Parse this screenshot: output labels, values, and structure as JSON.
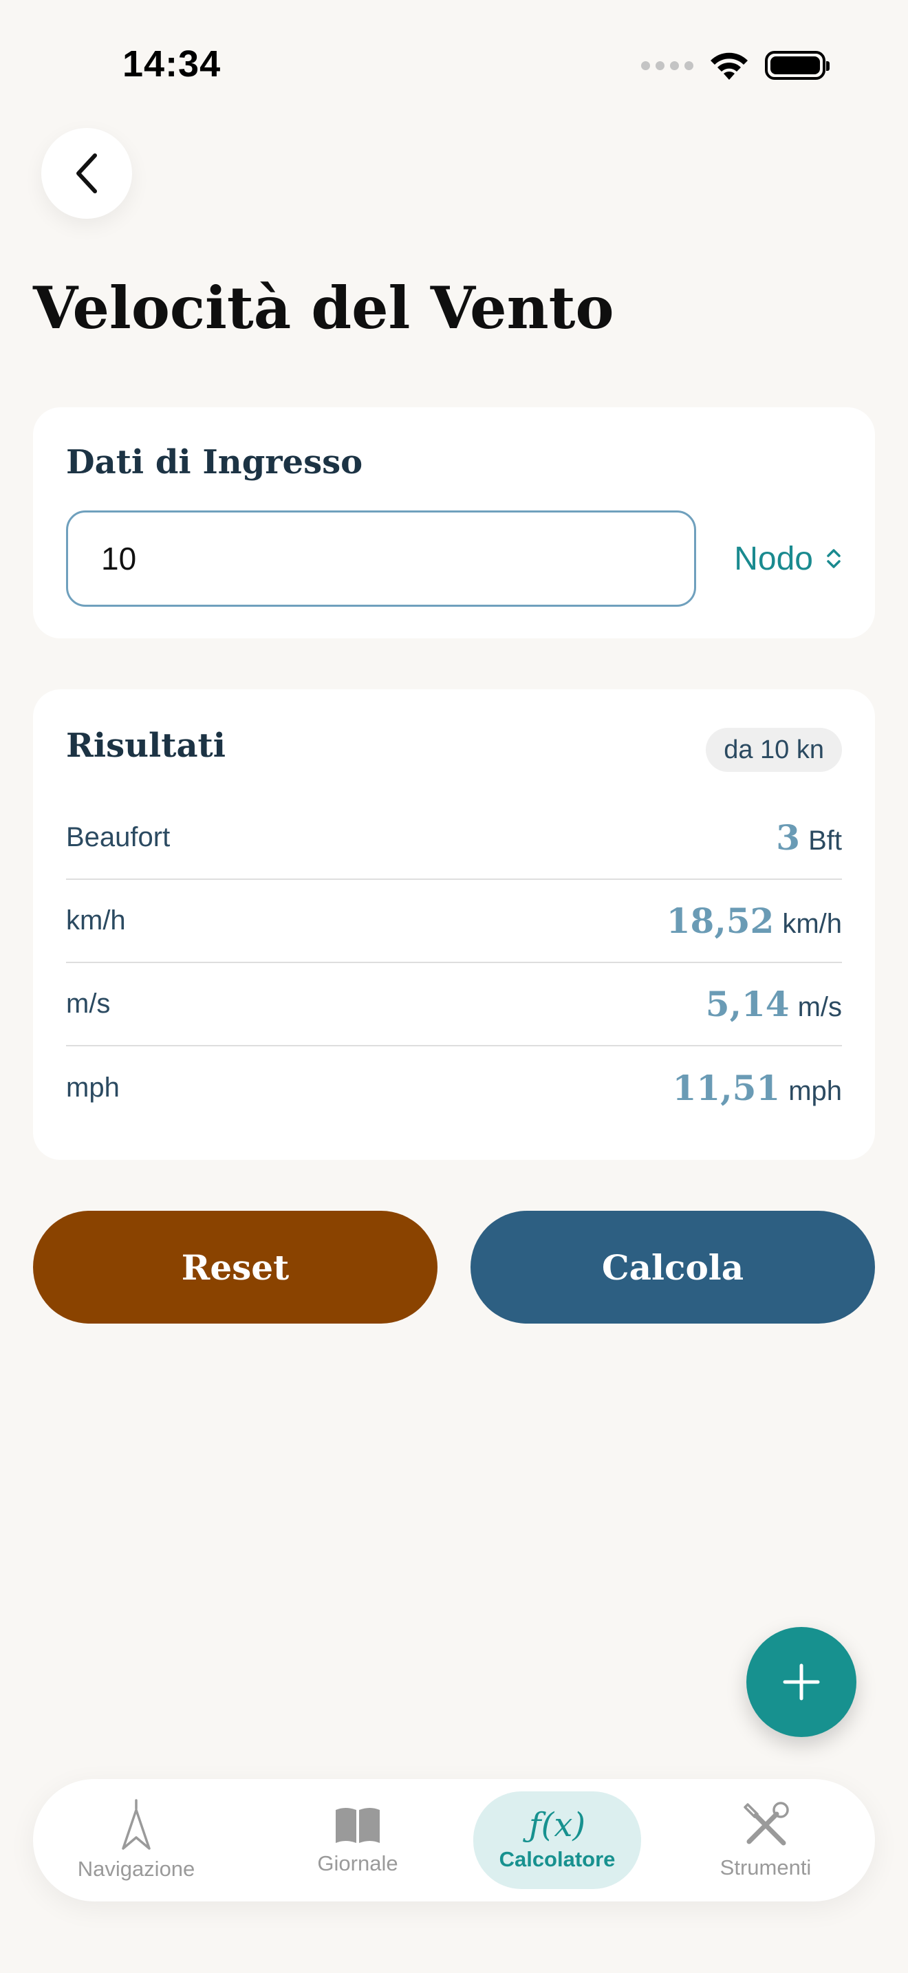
{
  "status_bar": {
    "time": "14:34"
  },
  "header": {
    "title": "Velocità del Vento"
  },
  "input_card": {
    "title": "Dati di Ingresso",
    "input_value": "10",
    "unit": "Nodo"
  },
  "results_card": {
    "title": "Risultati",
    "badge": "da 10 kn",
    "rows": [
      {
        "label": "Beaufort",
        "value": "3",
        "unit": "Bft"
      },
      {
        "label": "km/h",
        "value": "18,52",
        "unit": "km/h"
      },
      {
        "label": "m/s",
        "value": "5,14",
        "unit": "m/s"
      },
      {
        "label": "mph",
        "value": "11,51",
        "unit": "mph"
      }
    ]
  },
  "actions": {
    "reset_label": "Reset",
    "calculate_label": "Calcola"
  },
  "tab_bar": {
    "items": [
      {
        "label": "Navigazione",
        "icon": "compass-icon"
      },
      {
        "label": "Giornale",
        "icon": "book-icon"
      },
      {
        "label": "Calcolatore",
        "icon": "function-icon"
      },
      {
        "label": "Strumenti",
        "icon": "tools-icon"
      }
    ],
    "active": "Calcolatore",
    "function_glyph": "ƒ(x)"
  },
  "colors": {
    "background": "#f9f7f4",
    "accent": "#17918f",
    "reset": "#8a4300",
    "calculate": "#2d5f82",
    "result_value": "#6a9bb5"
  }
}
